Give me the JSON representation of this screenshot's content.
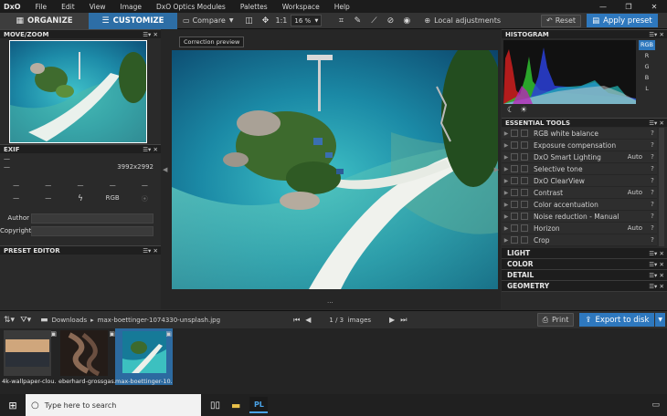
{
  "menubar": {
    "logo": "DxO",
    "items": [
      "File",
      "Edit",
      "View",
      "Image",
      "DxO Optics Modules",
      "Palettes",
      "Workspace",
      "Help"
    ],
    "window_controls": [
      "—",
      "❐",
      "✕"
    ]
  },
  "toolbar": {
    "organize_label": "ORGANIZE",
    "customize_label": "CUSTOMIZE",
    "compare_label": "Compare",
    "one_to_one": "1:1",
    "zoom_value": "16 %",
    "local_adjustments_label": "Local adjustments",
    "reset_label": "Reset",
    "apply_preset_label": "Apply preset",
    "tooltip": "Correction preview"
  },
  "left_panel": {
    "move_zoom_title": "MOVE/ZOOM",
    "exif_title": "EXIF",
    "exif_dash1": "—",
    "exif_dash2": "—",
    "dimensions": "3992x2992",
    "grid_values": [
      "—",
      "—",
      "—",
      "—",
      "—",
      "—",
      "—"
    ],
    "rgb_label": "RGB",
    "author_label": "Author",
    "copyright_label": "Copyright",
    "preset_editor_title": "PRESET EDITOR"
  },
  "right_panel": {
    "histogram_title": "HISTOGRAM",
    "channels": [
      "RGB",
      "R",
      "G",
      "B",
      "L"
    ],
    "essential_tools_title": "ESSENTIAL TOOLS",
    "tools": [
      {
        "label": "RGB white balance",
        "auto": ""
      },
      {
        "label": "Exposure compensation",
        "auto": ""
      },
      {
        "label": "DxO Smart Lighting",
        "auto": "Auto"
      },
      {
        "label": "Selective tone",
        "auto": ""
      },
      {
        "label": "DxO ClearView",
        "auto": ""
      },
      {
        "label": "Contrast",
        "auto": "Auto"
      },
      {
        "label": "Color accentuation",
        "auto": ""
      },
      {
        "label": "Noise reduction - Manual",
        "auto": ""
      },
      {
        "label": "Horizon",
        "auto": "Auto"
      },
      {
        "label": "Crop",
        "auto": ""
      }
    ],
    "palettes": [
      "LIGHT",
      "COLOR",
      "DETAIL",
      "GEOMETRY"
    ],
    "tool_help": "?",
    "palette_controls": "☰▾ ✕"
  },
  "filmbar": {
    "breadcrumb_root": "Downloads",
    "breadcrumb_sep": "▸",
    "breadcrumb_file": "max-boettinger-1074330-unsplash.jpg",
    "counter": "1 / 3  images",
    "print_label": "Print",
    "export_label": "Export to disk",
    "handle": "···"
  },
  "filmstrip": {
    "thumbs": [
      {
        "caption": "4k-wallpaper-clou..."
      },
      {
        "caption": "eberhard-grossgas..."
      },
      {
        "caption": "max-boettinger-10..."
      }
    ]
  },
  "taskbar": {
    "search_placeholder": "Type here to search",
    "app_label": "PL"
  },
  "colors": {
    "accent": "#2e78be",
    "customize_tab": "#2d6ea6"
  }
}
